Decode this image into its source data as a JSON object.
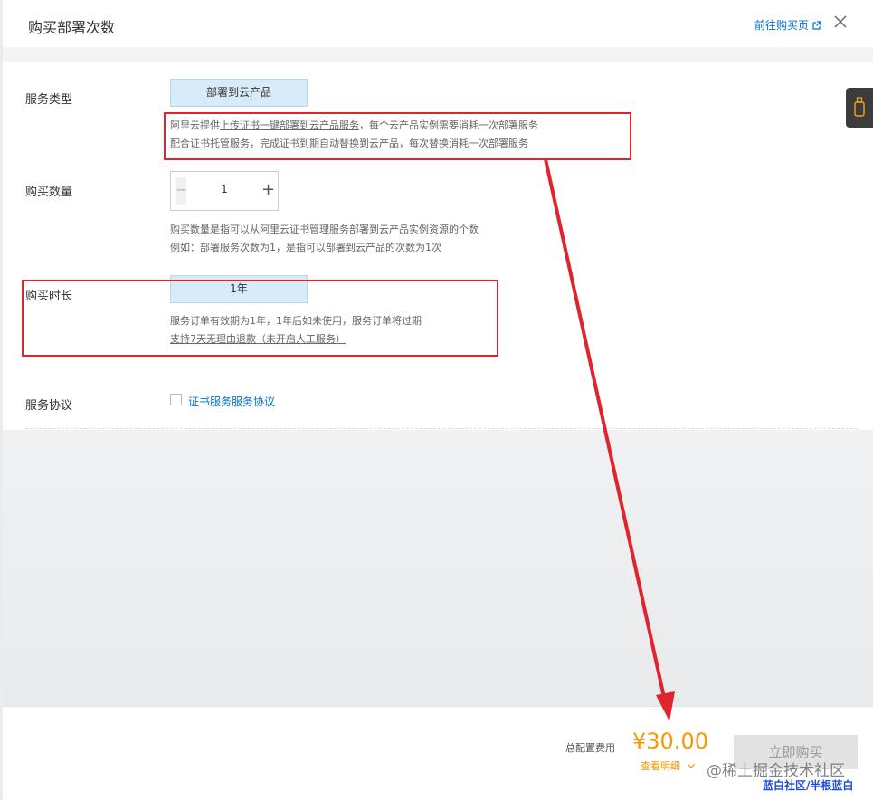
{
  "dialog": {
    "title": "购买部署次数",
    "goto_link": "前往购买页",
    "close_icon": "close-icon"
  },
  "service_type": {
    "label": "服务类型",
    "selected": "部署到云产品",
    "help_line1_prefix": "阿里云提供",
    "help_line1_link": "上传证书一键部署到云产品服务",
    "help_line1_suffix": "，每个云产品实例需要消耗一次部署服务",
    "help_line2_link": "配合证书托管服务",
    "help_line2_suffix": "，完成证书到期自动替换到云产品，每次替换消耗一次部署服务"
  },
  "quantity": {
    "label": "购买数量",
    "value": "1",
    "minus": "−",
    "plus": "+",
    "help_line1": "购买数量是指可以从阿里云证书管理服务部署到云产品实例资源的个数",
    "help_line2": "例如：部署服务次数为1，是指可以部署到云产品的次数为1次"
  },
  "duration": {
    "label": "购买时长",
    "selected": "1年",
    "help_line1": "服务订单有效期为1年，1年后如未使用，服务订单将过期",
    "help_line2_link": "支持7天无理由退款（未开启人工服务）"
  },
  "agreement": {
    "label": "服务协议",
    "link": "证书服务服务协议",
    "checked": false
  },
  "footer": {
    "total_label": "总配置费用",
    "price": "¥30.00",
    "detail_link": "查看明细",
    "buy_button": "立即购买"
  },
  "watermark": {
    "line1": "@稀土掘金技术社区",
    "line2": "蓝白社区/半根蓝白"
  },
  "colors": {
    "accent_link": "#0070cc",
    "price": "#f59a00",
    "highlight_red": "#e0242d",
    "selected_bg": "#d8ebf8"
  }
}
